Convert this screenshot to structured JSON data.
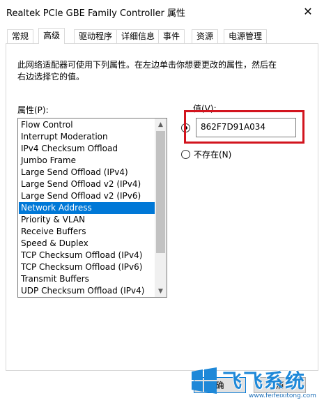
{
  "window": {
    "title": "Realtek PCIe GBE Family Controller 属性",
    "close_glyph": "✕"
  },
  "tabs": [
    {
      "label": "常规",
      "active": false
    },
    {
      "label": "高级",
      "active": true
    },
    {
      "label": "驱动程序",
      "active": false
    },
    {
      "label": "详细信息",
      "active": false
    },
    {
      "label": "事件",
      "active": false
    },
    {
      "label": "资源",
      "active": false
    },
    {
      "label": "电源管理",
      "active": false
    }
  ],
  "advanced": {
    "description": "此网络适配器可使用下列属性。在左边单击你想要更改的属性，然后在右边选择它的值。",
    "property_label": "属性(P):",
    "value_label": "值(V):",
    "properties": [
      "Flow Control",
      "Interrupt Moderation",
      "IPv4 Checksum Offload",
      "Jumbo Frame",
      "Large Send Offload (IPv4)",
      "Large Send Offload v2 (IPv4)",
      "Large Send Offload v2 (IPv6)",
      "Network Address",
      "Priority & VLAN",
      "Receive Buffers",
      "Speed & Duplex",
      "TCP Checksum Offload (IPv4)",
      "TCP Checksum Offload (IPv6)",
      "Transmit Buffers",
      "UDP Checksum Offload (IPv4)"
    ],
    "selected_property": "Network Address",
    "value": "862F7D91A034",
    "value_radio_checked": true,
    "not_present_label": "不存在(N)",
    "not_present_checked": false
  },
  "buttons": {
    "ok_partial": "确",
    "cancel_partial": "消"
  },
  "watermark": {
    "brand": "飞飞系统",
    "url": "www.feifeixitong.com"
  },
  "colors": {
    "selection": "#0078d7",
    "highlight_box": "#d2141e",
    "brand_blue": "#1e88d8"
  }
}
